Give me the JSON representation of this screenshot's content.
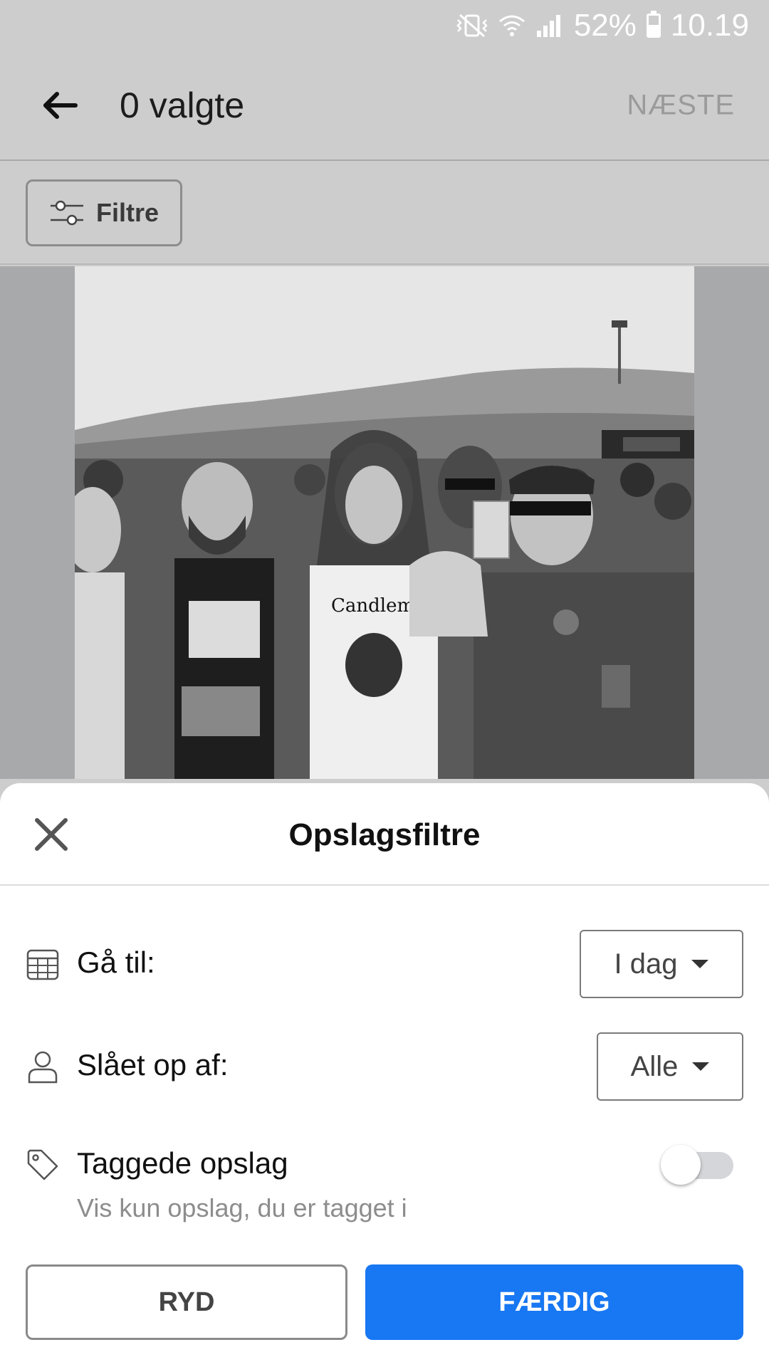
{
  "status_bar": {
    "battery_percent": "52%",
    "time": "10.19",
    "icons": [
      "vibrate-mute-icon",
      "wifi-icon",
      "signal-icon",
      "battery-icon"
    ]
  },
  "app_bar": {
    "back_icon": "arrow-left-icon",
    "title": "0 valgte",
    "next_label": "NÆSTE"
  },
  "filter_bar": {
    "icon": "sliders-icon",
    "label": "Filtre"
  },
  "photo": {
    "description_shirt_text": "Candlemass"
  },
  "sheet": {
    "close_icon": "close-icon",
    "title": "Opslagsfiltre",
    "goto": {
      "icon": "calendar-icon",
      "label": "Gå til:",
      "value": "I dag"
    },
    "posted_by": {
      "icon": "person-icon",
      "label": "Slået op af:",
      "value": "Alle"
    },
    "tagged": {
      "icon": "tag-icon",
      "label": "Taggede opslag",
      "sublabel": "Vis kun opslag, du er tagget i",
      "enabled": false
    },
    "clear_label": "RYD",
    "done_label": "FÆRDIG"
  },
  "colors": {
    "primary": "#1877f2",
    "dim_background": "#cdcdcd",
    "photo_backdrop": "#a8a9ab"
  }
}
